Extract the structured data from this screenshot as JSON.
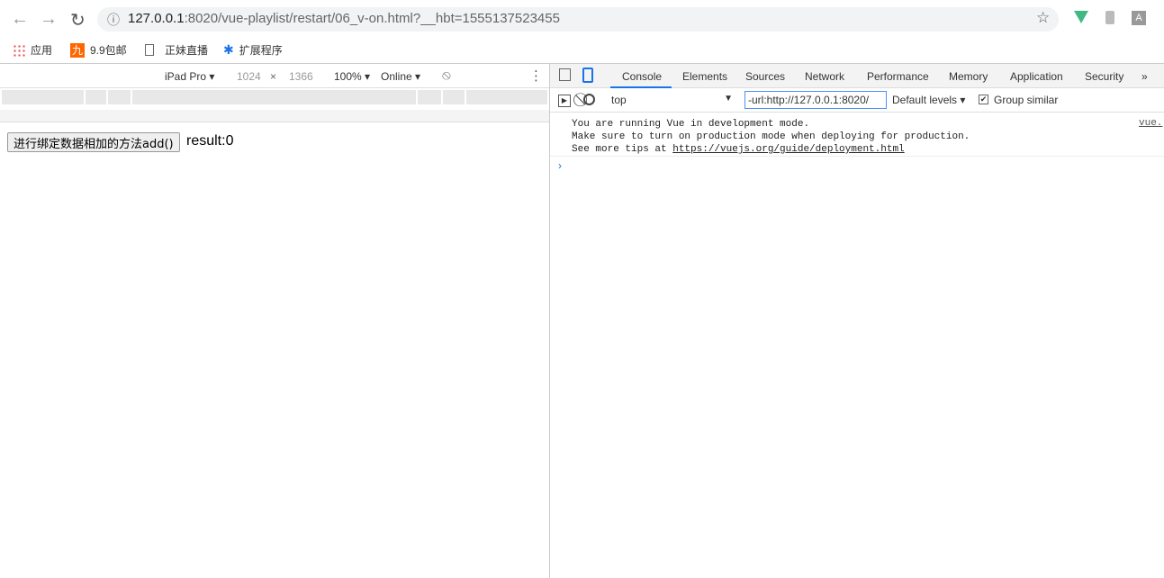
{
  "browser": {
    "url_host": "127.0.0.1",
    "url_rest": ":8020/vue-playlist/restart/06_v-on.html?__hbt=1555137523455"
  },
  "bookmarks": [
    {
      "label": "应用",
      "icon": "apps-icon"
    },
    {
      "label": "9.9包邮",
      "icon": "jiu-icon",
      "badge": "九"
    },
    {
      "label": "正妹直播",
      "icon": "page-icon"
    },
    {
      "label": "扩展程序",
      "icon": "puzzle-icon"
    }
  ],
  "device_toolbar": {
    "device": "iPad Pro",
    "width": "1024",
    "x": "×",
    "height": "1366",
    "zoom": "100%",
    "network": "Online"
  },
  "page": {
    "button_label": "进行绑定数据相加的方法add()",
    "result": "result:0"
  },
  "devtools": {
    "tabs": [
      "Console",
      "Elements",
      "Sources",
      "Network",
      "Performance",
      "Memory",
      "Application",
      "Security"
    ],
    "active_tab": "Console",
    "more": "»",
    "context": "top",
    "filter": "-url:http://127.0.0.1:8020/",
    "levels": "Default levels",
    "group_similar": "Group similar",
    "messages": {
      "line1": "You are running Vue in development mode.",
      "line2": "Make sure to turn on production mode when deploying for production.",
      "line3_prefix": "See more tips at ",
      "link": "https://vuejs.org/guide/deployment.html",
      "source": "vue."
    },
    "prompt": "›"
  },
  "colors": {
    "accent": "#1a73e8",
    "vue": "#41b883"
  }
}
